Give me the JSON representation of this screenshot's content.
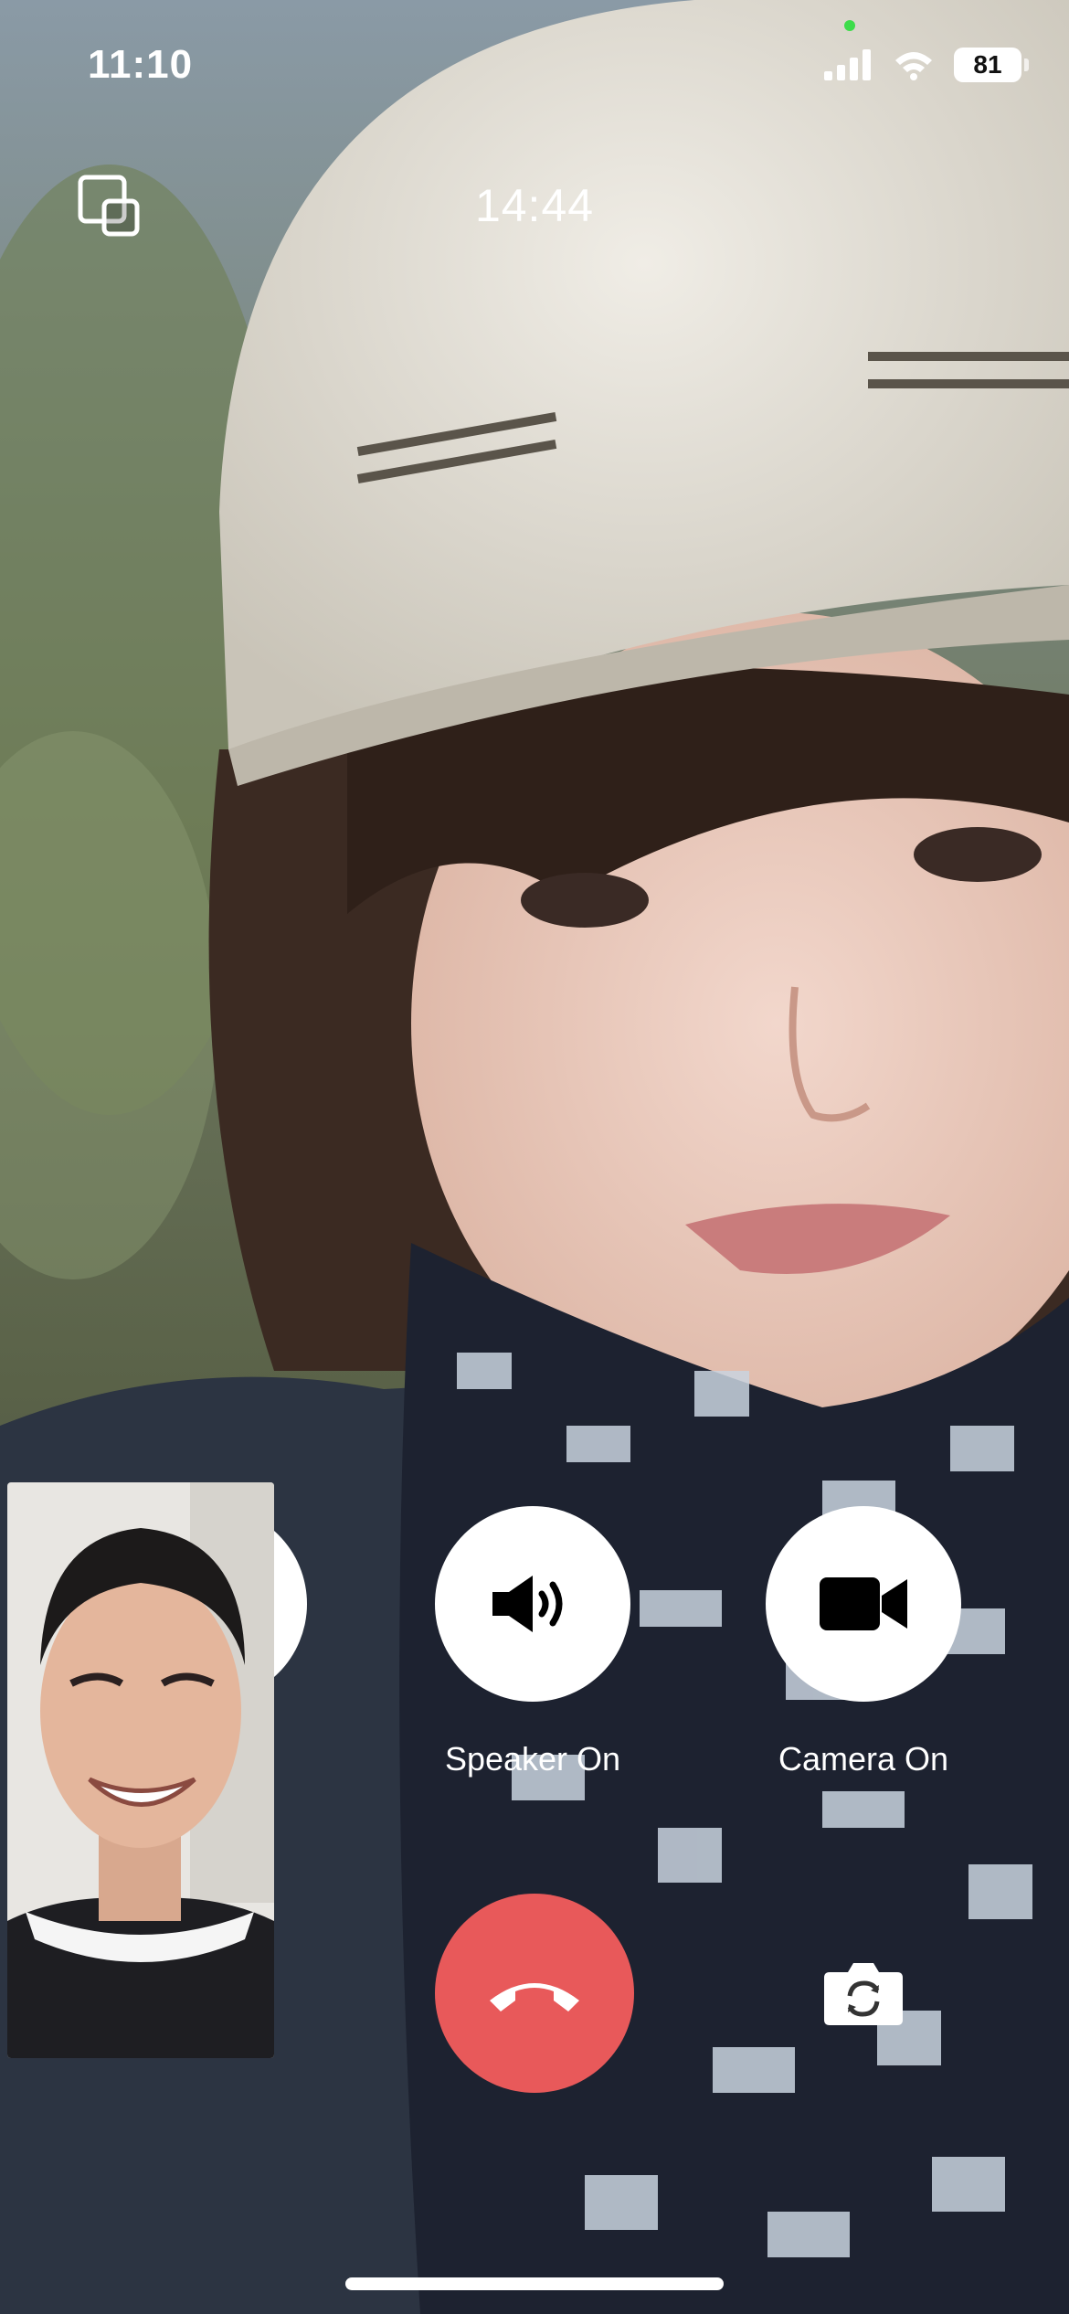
{
  "status_bar": {
    "time": "11:10",
    "battery": "81"
  },
  "call": {
    "duration": "14:44"
  },
  "controls": {
    "speaker_label": "Speaker On",
    "camera_label": "Camera On"
  },
  "icons": {
    "pip": "picture-in-picture-icon",
    "speaker": "speaker-icon",
    "camera": "video-camera-icon",
    "end_call": "phone-hangup-icon",
    "flip": "camera-flip-icon"
  },
  "colors": {
    "end_call": "#e8595a",
    "camera_indicator": "#3ddc4a"
  }
}
